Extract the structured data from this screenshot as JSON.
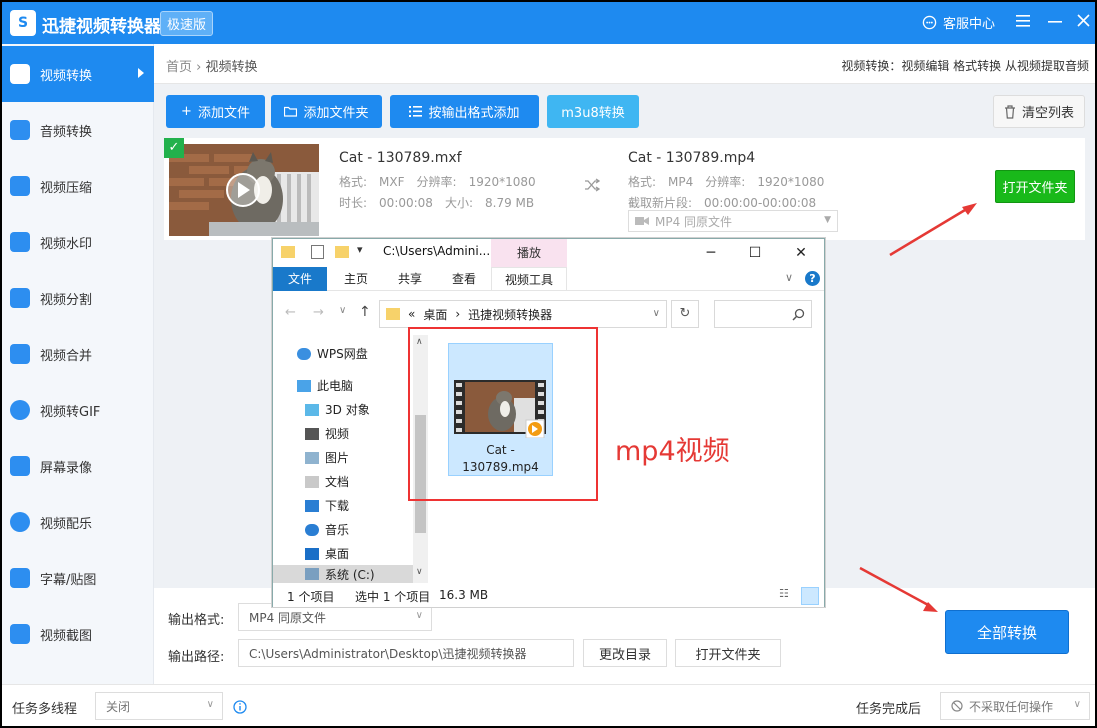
{
  "app": {
    "title": "迅捷视频转换器",
    "edition": "极速版",
    "service": "客服中心",
    "logo_glyph": "S"
  },
  "sidebar": {
    "items": [
      {
        "label": "视频转换",
        "icon": "video-convert-icon",
        "active": true
      },
      {
        "label": "音频转换",
        "icon": "audio-convert-icon"
      },
      {
        "label": "视频压缩",
        "icon": "video-compress-icon"
      },
      {
        "label": "视频水印",
        "icon": "video-watermark-icon"
      },
      {
        "label": "视频分割",
        "icon": "video-split-icon"
      },
      {
        "label": "视频合并",
        "icon": "video-merge-icon"
      },
      {
        "label": "视频转GIF",
        "icon": "video-gif-icon"
      },
      {
        "label": "屏幕录像",
        "icon": "screen-record-icon"
      },
      {
        "label": "视频配乐",
        "icon": "video-music-icon"
      },
      {
        "label": "字幕/贴图",
        "icon": "subtitle-sticker-icon"
      },
      {
        "label": "视频截图",
        "icon": "video-screenshot-icon"
      }
    ]
  },
  "breadcrumb": {
    "home": "首页",
    "sep": "›",
    "current": "视频转换"
  },
  "topbar_links": "视频转换：视频编辑 格式转换 从视频提取音频",
  "toolbar": {
    "add_file": "添加文件",
    "add_folder": "添加文件夹",
    "add_by_format": "按输出格式添加",
    "m3u8": "m3u8转换",
    "clear_list": "清空列表"
  },
  "file": {
    "src_name": "Cat - 130789.mxf",
    "src_format_label": "格式:",
    "src_format": "MXF",
    "src_res_label": "分辨率:",
    "src_res": "1920*1080",
    "src_dur_label": "时长:",
    "src_dur": "00:00:08",
    "src_size_label": "大小:",
    "src_size": "8.79 MB",
    "dst_name": "Cat - 130789.mp4",
    "dst_format_label": "格式:",
    "dst_format": "MP4",
    "dst_res_label": "分辨率:",
    "dst_res": "1920*1080",
    "dst_clip_label": "截取新片段:",
    "dst_clip": "00:00:00-00:00:08",
    "dst_select": "MP4  同原文件",
    "open_folder": "打开文件夹"
  },
  "bottom": {
    "output_format_label": "输出格式:",
    "output_format_value": "MP4  同原文件",
    "output_path_label": "输出路径:",
    "output_path_value": "C:\\Users\\Administrator\\Desktop\\迅捷视频转换器",
    "change_dir": "更改目录",
    "open_folder": "打开文件夹",
    "convert_all": "全部转换"
  },
  "footer": {
    "multithread_label": "任务多线程",
    "multithread_value": "关闭",
    "after_done_label": "任务完成后",
    "after_done_value": "不采取任何操作"
  },
  "explorer": {
    "title_path": "C:\\Users\\Admini...",
    "play_tab": "播放",
    "tabs": [
      "文件",
      "主页",
      "共享",
      "查看",
      "视频工具"
    ],
    "address": [
      "桌面",
      "迅捷视频转换器"
    ],
    "address_prefix": "«",
    "nav": [
      {
        "label": "WPS网盘",
        "icon": "cloud-icon"
      },
      {
        "label": "此电脑",
        "icon": "computer-icon"
      },
      {
        "label": "3D 对象",
        "icon": "cube-icon"
      },
      {
        "label": "视频",
        "icon": "film-icon"
      },
      {
        "label": "图片",
        "icon": "picture-icon"
      },
      {
        "label": "文档",
        "icon": "document-icon"
      },
      {
        "label": "下载",
        "icon": "download-icon"
      },
      {
        "label": "音乐",
        "icon": "music-icon"
      },
      {
        "label": "桌面",
        "icon": "desktop-icon"
      },
      {
        "label": "系统 (C:)",
        "icon": "drive-icon"
      }
    ],
    "file_tile": "Cat - 130789.mp4",
    "status_count": "1 个项目",
    "status_selected": "选中 1 个项目",
    "status_size": "16.3 MB"
  },
  "annotation": "mp4视频",
  "colors": {
    "primary": "#1e8af0",
    "green": "#19b91a",
    "annotation_red": "#e53935"
  }
}
